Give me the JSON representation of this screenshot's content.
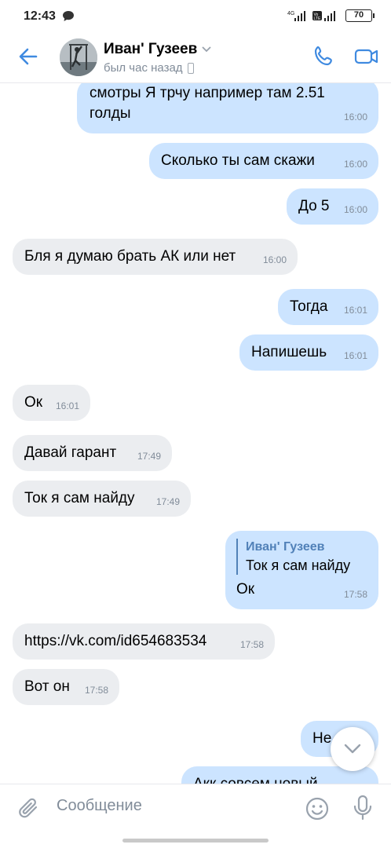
{
  "status_bar": {
    "time": "12:43",
    "network_left": "4G",
    "network_right": "Vo LTE",
    "battery": "70"
  },
  "header": {
    "contact_name": "Иван' Гузеев",
    "contact_status": "был час назад"
  },
  "messages": [
    {
      "dir": "out",
      "text": "смотры Я трчу например там 2.51 голды",
      "time": "16:00"
    },
    {
      "dir": "out",
      "text": "Сколько ты сам скажи",
      "time": "16:00"
    },
    {
      "dir": "out",
      "text": "До 5",
      "time": "16:00"
    },
    {
      "dir": "in",
      "text": "Бля я думаю брать АК или нет",
      "time": "16:00"
    },
    {
      "dir": "out",
      "text": "Тогда",
      "time": "16:01"
    },
    {
      "dir": "out",
      "text": "Напишешь",
      "time": "16:01"
    },
    {
      "dir": "in",
      "text": "Ок",
      "time": "16:01"
    },
    {
      "dir": "in",
      "text": "Давай гарант",
      "time": "17:49"
    },
    {
      "dir": "in",
      "text": "Ток я сам найду",
      "time": "17:49"
    },
    {
      "dir": "out",
      "reply_name": "Иван' Гузеев",
      "reply_text": "Ток я сам найду",
      "text": "Ок",
      "time": "17:58"
    },
    {
      "dir": "in",
      "text": "https://vk.com/id654683534",
      "time": "17:58",
      "is_link": true
    },
    {
      "dir": "in",
      "text": "Вот он",
      "time": "17:58"
    },
    {
      "dir": "out",
      "text": "Не",
      "time": ""
    },
    {
      "dir": "out",
      "text": "Акк совсем новый",
      "time": ""
    }
  ],
  "composer": {
    "placeholder": "Сообщение"
  },
  "colors": {
    "accent": "#5181b8",
    "outgoing_bubble": "#cce4ff",
    "incoming_bubble": "#ebedf0"
  }
}
